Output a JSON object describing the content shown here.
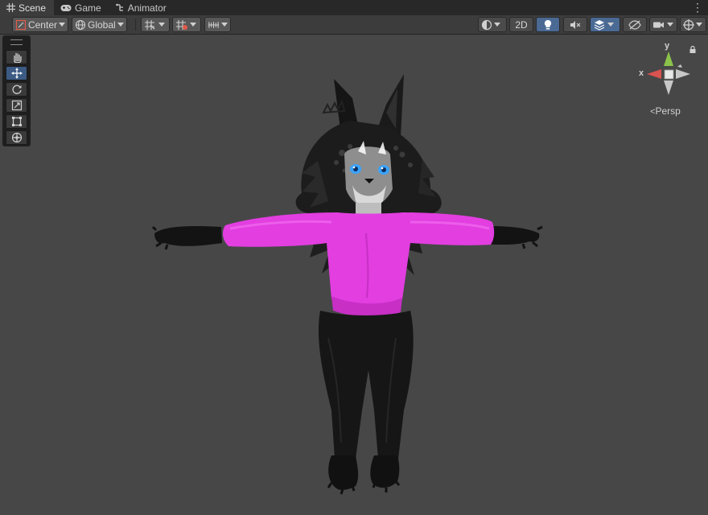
{
  "tabs": [
    {
      "label": "Scene",
      "icon": "grid-icon",
      "active": true
    },
    {
      "label": "Game",
      "icon": "gamepad-icon",
      "active": false
    },
    {
      "label": "Animator",
      "icon": "animator-icon",
      "active": false
    }
  ],
  "toolbar": {
    "pivot_label": "Center",
    "space_label": "Global",
    "mode_2d_label": "2D"
  },
  "gizmo": {
    "y_label": "y",
    "x_label": "x",
    "projection_label": "Persp"
  },
  "colors": {
    "tabbar": "#282828",
    "toolbar": "#3c3c3c",
    "scene_bg": "#474747",
    "active_blue": "#4a6a94",
    "shirt": "#e23ee0",
    "x_axis": "#d9534f",
    "y_axis": "#8bc34a"
  }
}
